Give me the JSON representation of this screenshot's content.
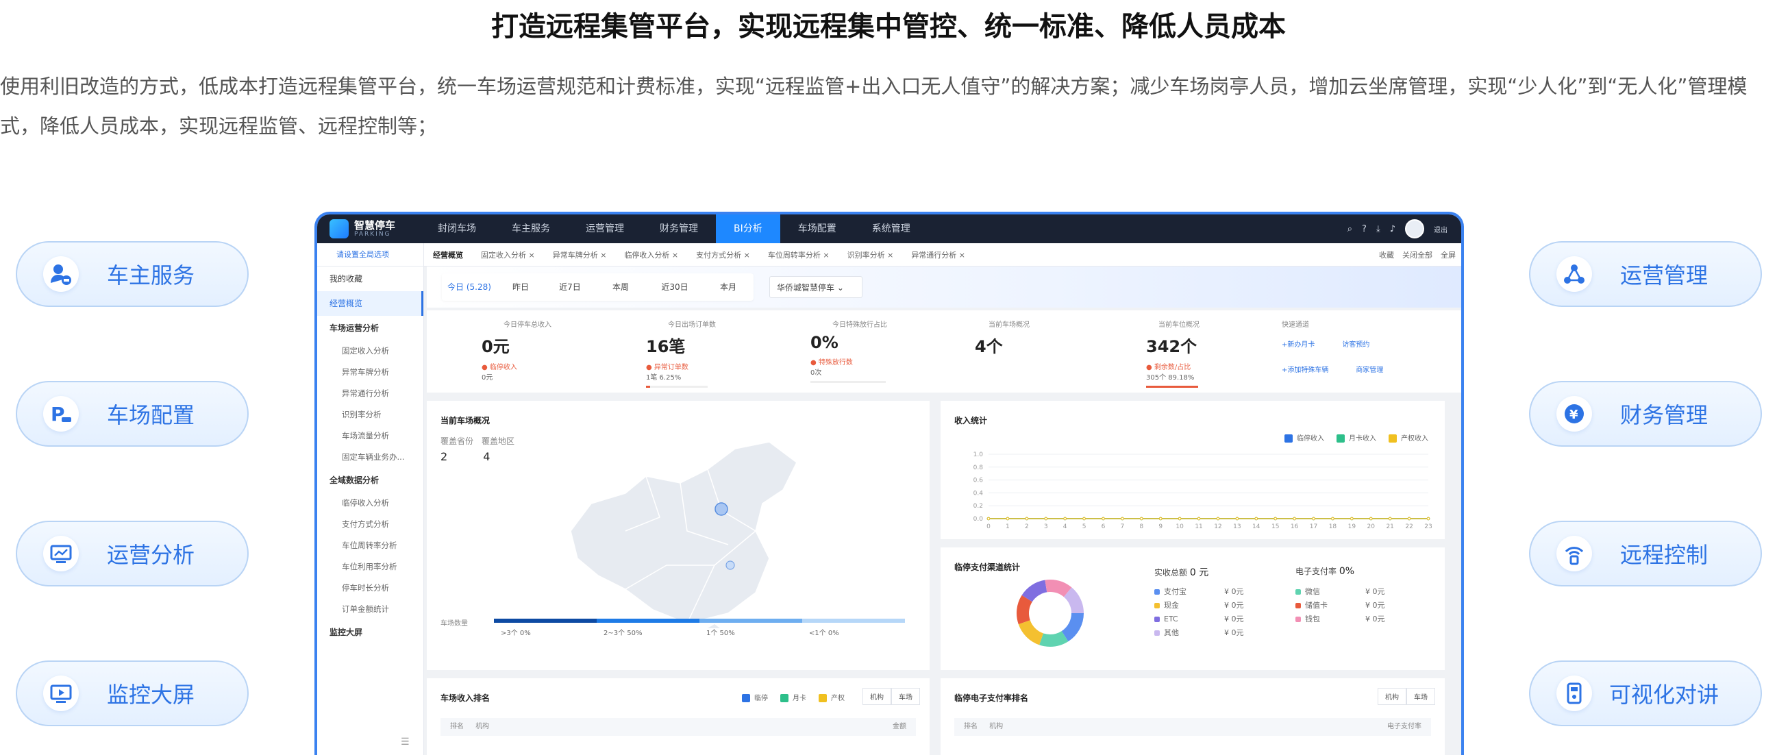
{
  "page": {
    "title": "打造远程集管平台，实现远程集中管控、统一标准、降低人员成本",
    "description": "使用利旧改造的方式，低成本打造远程集管平台，统一车场运营规范和计费标准，实现“远程监管+出入口无人值守”的解决方案；减少车场岗亭人员，增加云坐席管理，实现“少人化”到“无人化”管理模式，降低人员成本，实现远程监管、远程控制等；"
  },
  "features_left": [
    {
      "label": "车主服务",
      "icon": "driver-service-icon"
    },
    {
      "label": "车场配置",
      "icon": "parking-config-icon"
    },
    {
      "label": "运营分析",
      "icon": "operation-analysis-icon"
    },
    {
      "label": "监控大屏",
      "icon": "monitor-screen-icon"
    }
  ],
  "features_right": [
    {
      "label": "运营管理",
      "icon": "operation-management-icon"
    },
    {
      "label": "财务管理",
      "icon": "finance-icon"
    },
    {
      "label": "远程控制",
      "icon": "remote-control-icon"
    },
    {
      "label": "可视化对讲",
      "icon": "intercom-icon"
    }
  ],
  "app": {
    "logo_title": "智慧停车",
    "logo_sub": "PARKING",
    "nav": [
      "封闭车场",
      "车主服务",
      "运营管理",
      "财务管理",
      "BI分析",
      "车场配置",
      "系统管理"
    ],
    "nav_active": "BI分析",
    "user_name": "退出",
    "scope_select": "请设置全局选项",
    "tabs": [
      "经营概览",
      "固定收入分析 ×",
      "异常车牌分析 ×",
      "临停收入分析 ×",
      "支付方式分析 ×",
      "车位周转率分析 ×",
      "识别率分析 ×",
      "异常通行分析 ×"
    ],
    "tabs_right": [
      "收藏",
      "关闭全部",
      "全屏"
    ],
    "sidebar": {
      "top": [
        "我的收藏",
        "经营概览"
      ],
      "group1": "车场运营分析",
      "group1_items": [
        "固定收入分析",
        "异常车牌分析",
        "异常通行分析",
        "识别率分析",
        "车场流量分析",
        "固定车辆业务办..."
      ],
      "group2": "全域数据分析",
      "group2_items": [
        "临停收入分析",
        "支付方式分析",
        "车位周转率分析",
        "车位利用率分析",
        "停车时长分析",
        "订单金额统计"
      ],
      "group3": "监控大屏"
    },
    "date_filters": [
      "今日 (5.28)",
      "昨日",
      "近7日",
      "本周",
      "近30日",
      "本月"
    ],
    "park_select": "华侨城智慧停车",
    "stats": [
      {
        "label": "今日停车总收入",
        "value": "0元",
        "sub1": "● 临停收入",
        "sub2": "0元"
      },
      {
        "label": "今日出场订单数",
        "value": "16笔",
        "sub1": "● 异常订单数",
        "sub2": "1笔  6.25%"
      },
      {
        "label": "今日特殊放行占比",
        "value": "0%",
        "sub1": "● 特殊放行数",
        "sub2": "0次"
      },
      {
        "label": "当前车场概况",
        "value": "4个",
        "sub1": "",
        "sub2": ""
      },
      {
        "label": "当前车位概况",
        "value": "342个",
        "sub1": "● 剩余数/占比",
        "sub2": "305个  89.18%"
      }
    ],
    "quick": {
      "label": "快速通道",
      "links": [
        "+新办月卡",
        "访客预约",
        "+添加特殊车辆",
        "商家管理"
      ]
    },
    "map_card": {
      "title": "当前车场概况",
      "k1": "覆盖省份",
      "k2": "覆盖地区",
      "v1": "2",
      "v2": "4",
      "scale_label": "车场数量",
      "scale": [
        ">3个  0%",
        "2~3个  50%",
        "1个  50%",
        "<1个  0%"
      ]
    },
    "income_card": {
      "title": "收入统计",
      "legend": [
        "临停收入",
        "月卡收入",
        "产权收入"
      ]
    },
    "pay_card": {
      "title": "临停支付渠道统计",
      "total_label": "实收总额",
      "total_value": "0 元",
      "rate_label": "电子支付率",
      "rate_value": "0%",
      "left_items": [
        {
          "name": "支付宝",
          "value": "¥ 0元"
        },
        {
          "name": "现金",
          "value": "¥ 0元"
        },
        {
          "name": "ETC",
          "value": "¥ 0元"
        },
        {
          "name": "其他",
          "value": "¥ 0元"
        }
      ],
      "right_items": [
        {
          "name": "微信",
          "value": "¥ 0元"
        },
        {
          "name": "储值卡",
          "value": "¥ 0元"
        },
        {
          "name": "钱包",
          "value": "¥ 0元"
        }
      ]
    },
    "rank_left": {
      "title": "车场收入排名",
      "legend": [
        "临停",
        "月卡",
        "产权"
      ],
      "btns": [
        "机构",
        "车场"
      ],
      "col1": "排名",
      "col2": "机构",
      "col3": "金额"
    },
    "rank_right": {
      "title": "临停电子支付率排名",
      "btns": [
        "机构",
        "车场"
      ],
      "col1": "排名",
      "col2": "机构",
      "col3": "电子支付率"
    }
  },
  "chart_data": {
    "type": "line",
    "title": "收入统计",
    "x": [
      0,
      1,
      2,
      3,
      4,
      5,
      6,
      7,
      8,
      9,
      10,
      11,
      12,
      13,
      14,
      15,
      16,
      17,
      18,
      19,
      20,
      21,
      22,
      23
    ],
    "ylim": [
      0,
      1.0
    ],
    "yticks": [
      "1.0",
      "0.8",
      "0.6",
      "0.4",
      "0.2",
      "0.0"
    ],
    "series": [
      {
        "name": "临停收入",
        "color": "#2d73e4",
        "values": [
          0,
          0,
          0,
          0,
          0,
          0,
          0,
          0,
          0,
          0,
          0,
          0,
          0,
          0,
          0,
          0,
          0,
          0,
          0,
          0,
          0,
          0,
          0,
          0
        ]
      },
      {
        "name": "月卡收入",
        "color": "#2dbf8a",
        "values": [
          0,
          0,
          0,
          0,
          0,
          0,
          0,
          0,
          0,
          0,
          0,
          0,
          0,
          0,
          0,
          0,
          0,
          0,
          0,
          0,
          0,
          0,
          0,
          0
        ]
      },
      {
        "name": "产权收入",
        "color": "#f0c020",
        "values": [
          0,
          0,
          0,
          0,
          0,
          0,
          0,
          0,
          0,
          0,
          0,
          0,
          0,
          0,
          0,
          0,
          0,
          0,
          0,
          0,
          0,
          0,
          0,
          0
        ]
      }
    ]
  }
}
